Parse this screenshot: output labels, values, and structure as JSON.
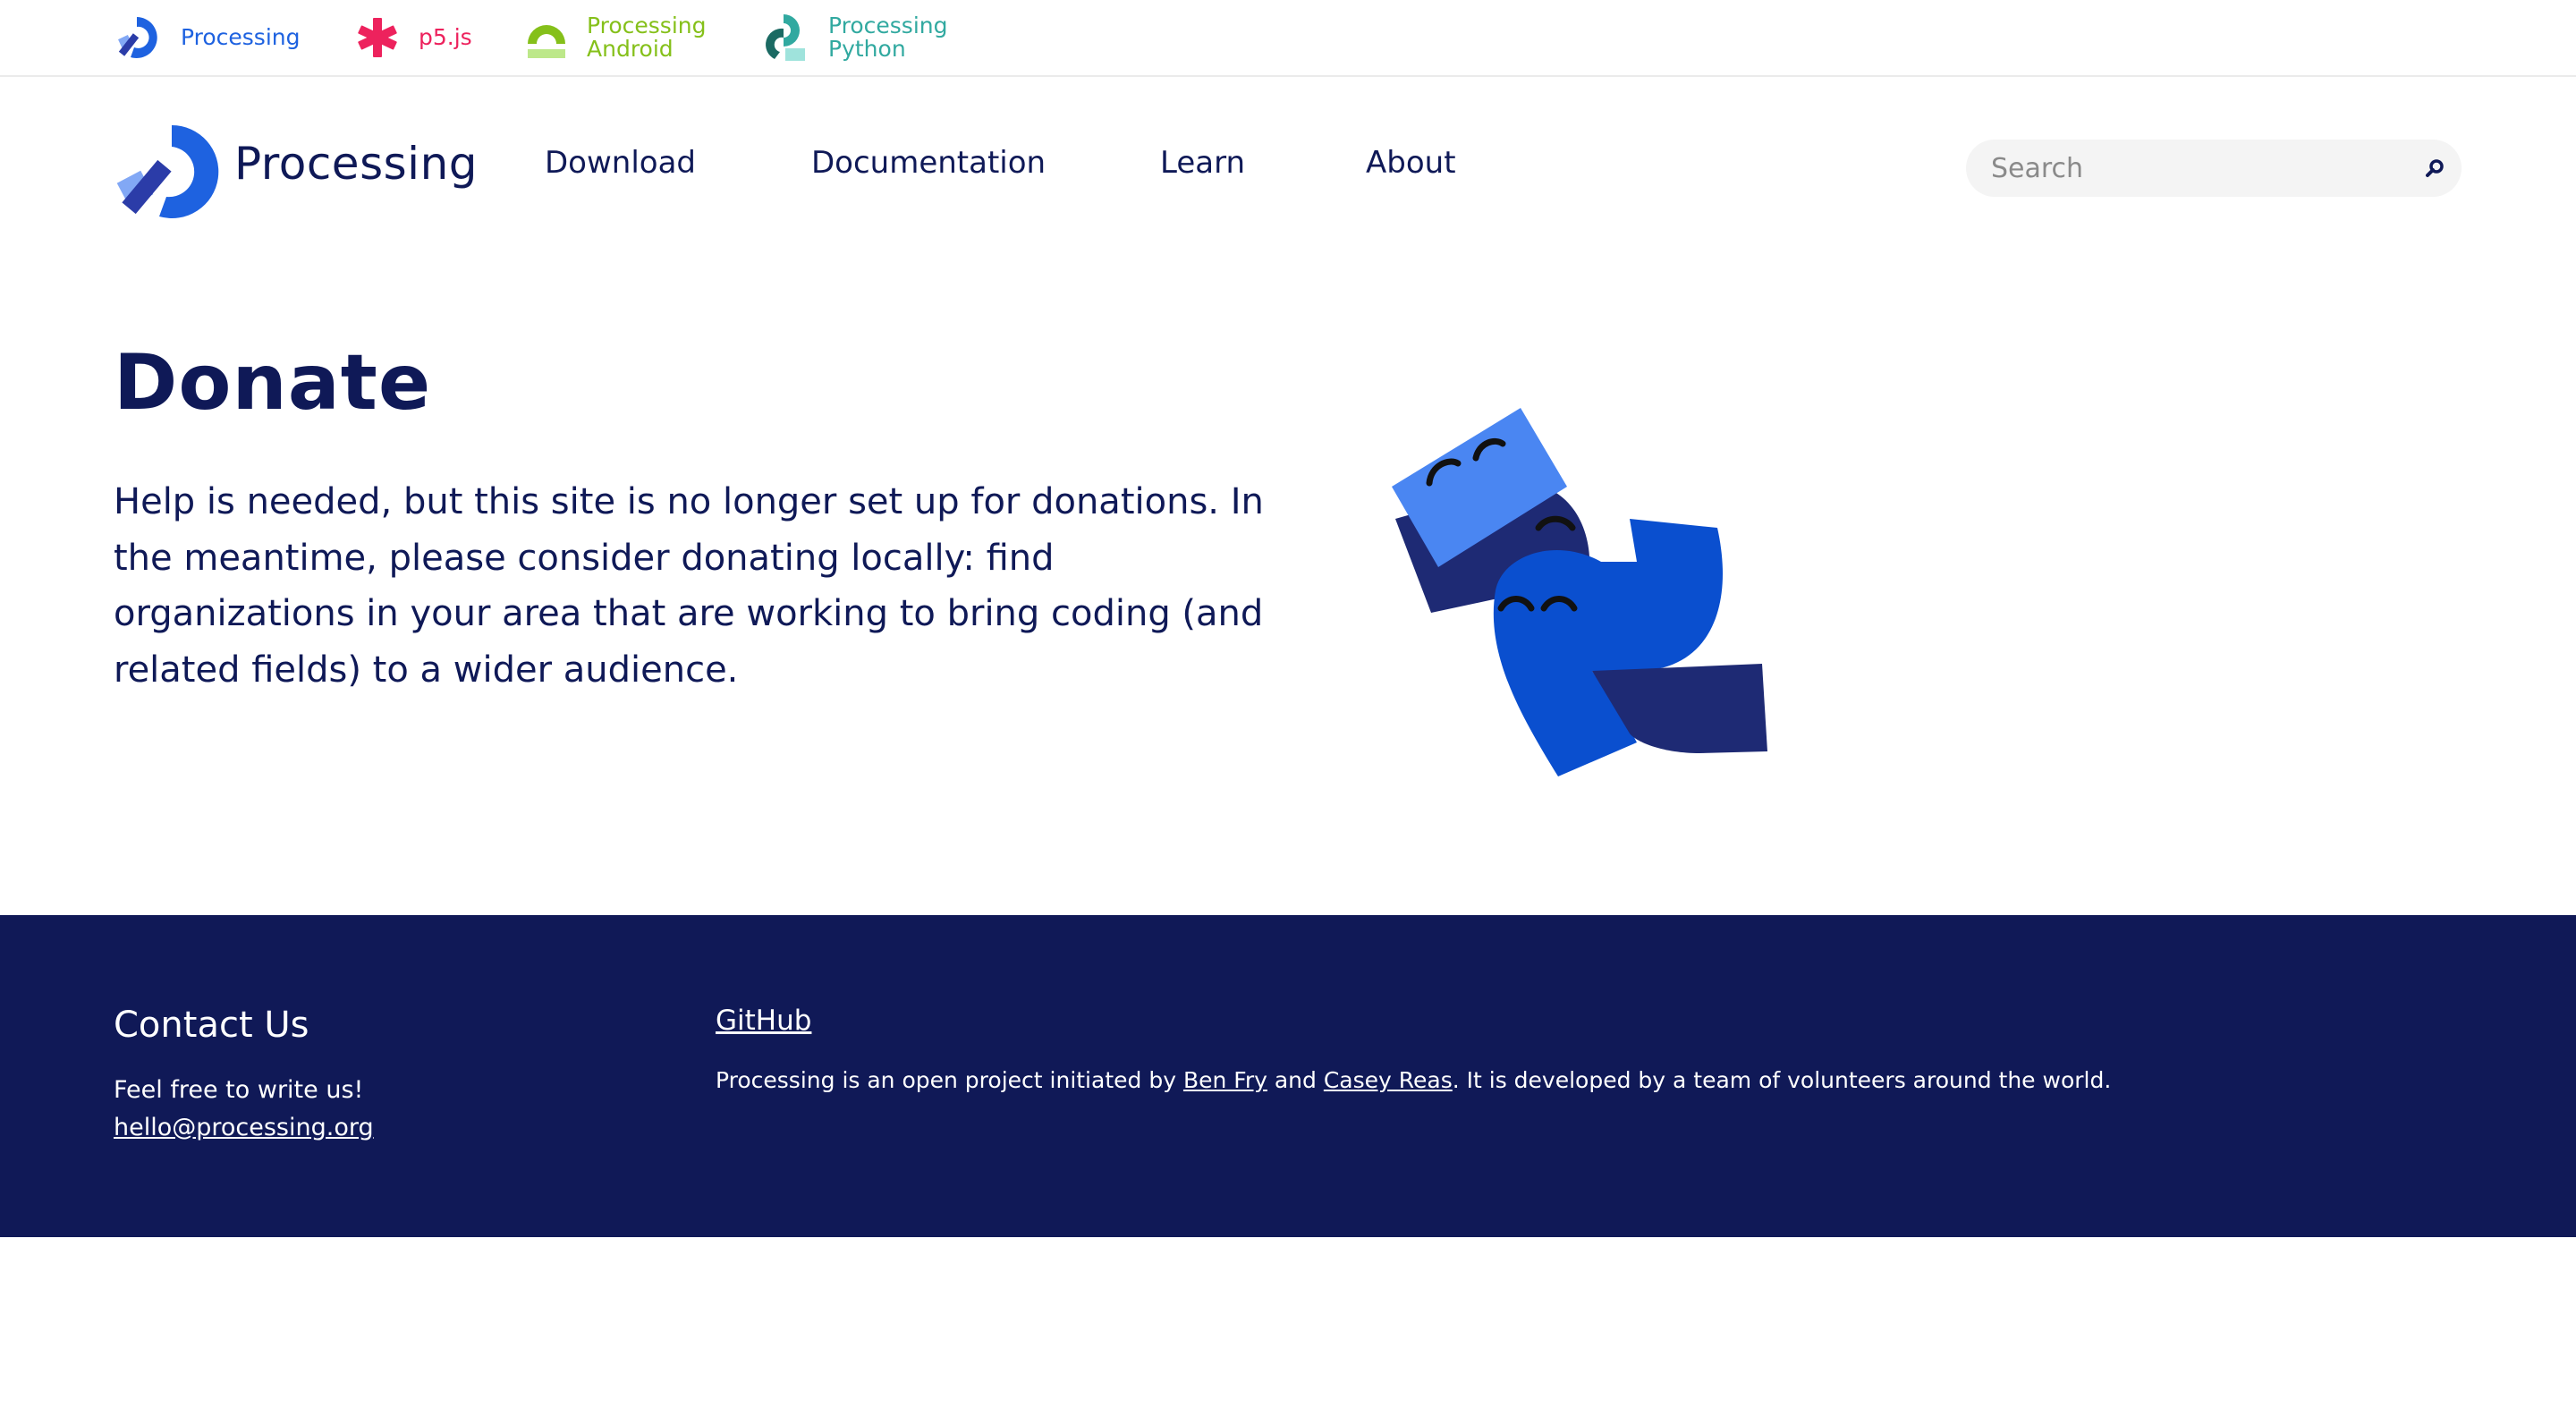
{
  "topbar": {
    "processing": "Processing",
    "p5js": "p5.js",
    "android": "Processing\nAndroid",
    "python": "Processing\nPython"
  },
  "header": {
    "logo_text": "Processing",
    "nav": {
      "download": "Download",
      "documentation": "Documentation",
      "learn": "Learn",
      "about": "About"
    },
    "search": {
      "placeholder": "Search",
      "value": ""
    }
  },
  "main": {
    "title": "Donate",
    "intro": "Help is needed, but this site is no longer set up for donations. In the meantime, please consider donating locally: find organizations in your area that are working to bring coding (and related fields) to a wider audience."
  },
  "footer": {
    "contact_heading": "Contact Us",
    "contact_text": "Feel free to write us!",
    "contact_email": "hello@processing.org",
    "github": "GitHub",
    "note_prefix": "Processing is an open project initiated by ",
    "ben_fry": "Ben Fry",
    "note_and": " and ",
    "casey_reas": "Casey Reas",
    "note_suffix": ". It is developed by a team of volunteers around the world."
  },
  "colors": {
    "navy": "#0f1957",
    "footer_bg": "#101957",
    "processing_blue": "#1e62e0",
    "p5_pink": "#ed225d",
    "android_green": "#85c01a",
    "python_teal": "#31a9a0"
  },
  "icons": [
    "processing-logo-icon",
    "p5js-asterisk-icon",
    "android-arch-icon",
    "python-logo-icon",
    "search-icon",
    "donate-illustration"
  ]
}
